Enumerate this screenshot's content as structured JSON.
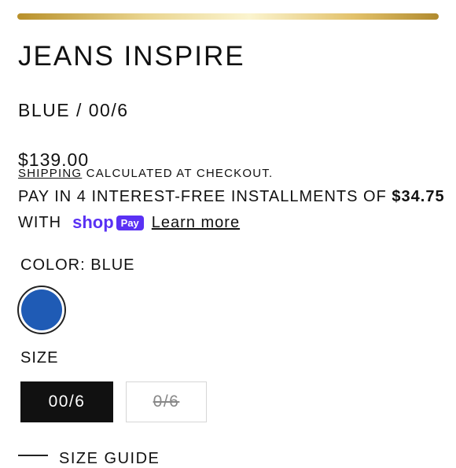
{
  "product": {
    "title": "JEANS INSPIRE",
    "variant": "BLUE / 00/6",
    "price": "$139.00"
  },
  "shipping": {
    "link_label": "SHIPPING",
    "text": "CALCULATED AT CHECKOUT."
  },
  "installments": {
    "text": "PAY IN 4 INTEREST-FREE INSTALLMENTS OF",
    "amount": "$34.75",
    "with_label": "WITH",
    "shop_label": "shop",
    "pay_label": "Pay",
    "learn_more": "Learn more"
  },
  "color": {
    "label": "COLOR: BLUE",
    "swatch_color": "#1f5bb5"
  },
  "size": {
    "label": "SIZE",
    "options": [
      {
        "label": "00/6",
        "selected": true,
        "available": true
      },
      {
        "label": "0/6",
        "selected": false,
        "available": false
      }
    ]
  },
  "size_guide": {
    "label": "SIZE GUIDE"
  }
}
